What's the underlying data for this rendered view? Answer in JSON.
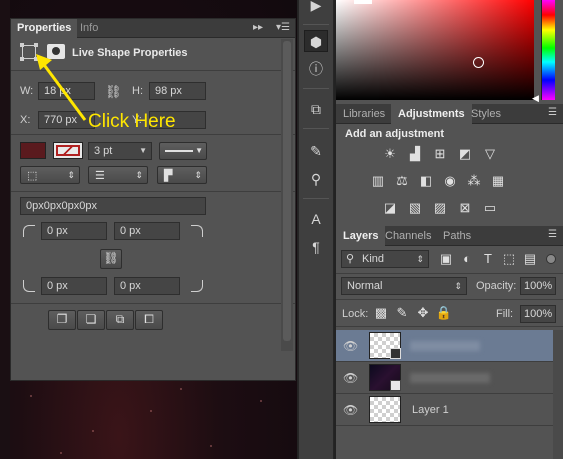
{
  "properties_panel": {
    "tabs": [
      "Properties",
      "Info"
    ],
    "header_title": "Live Shape Properties",
    "w_label": "W:",
    "w_value": "18 px",
    "h_label": "H:",
    "h_value": "98 px",
    "x_label": "X:",
    "x_value": "770 px",
    "y_label": "Y:",
    "stroke_width": "3 pt",
    "corner_text": "0px0px0px0px",
    "corner_tl": "0 px",
    "corner_tr": "0 px",
    "corner_bl": "0 px",
    "corner_br": "0 px"
  },
  "annotation": {
    "text": "Click Here",
    "color": "#ffe600"
  },
  "adjustments_panel": {
    "tabs": [
      "Libraries",
      "Adjustments",
      "Styles"
    ],
    "heading": "Add an adjustment",
    "icons": [
      "brightness-icon",
      "levels-icon",
      "curves-icon",
      "exposure-icon",
      "vibrance-icon",
      "hue-saturation-icon",
      "color-balance-icon",
      "black-white-icon",
      "photo-filter-icon",
      "channel-mixer-icon",
      "color-lookup-icon",
      "invert-icon",
      "posterize-icon",
      "threshold-icon",
      "selective-color-icon",
      "gradient-map-icon"
    ]
  },
  "layers_panel": {
    "tabs": [
      "Layers",
      "Channels",
      "Paths"
    ],
    "filter_kind": "Kind",
    "blend_mode": "Normal",
    "opacity_label": "Opacity:",
    "opacity_value": "100%",
    "lock_label": "Lock:",
    "fill_label": "Fill:",
    "fill_value": "100%",
    "layers": [
      {
        "name": "",
        "type": "shape",
        "selected": true
      },
      {
        "name": "",
        "type": "smart-object",
        "selected": false
      },
      {
        "name": "Layer 1",
        "type": "empty",
        "selected": false
      }
    ]
  },
  "colors": {
    "stroke_swatch": "#5a1a1e",
    "selected_layer": "#6b7b93",
    "accent_annotation": "#ffe600"
  }
}
